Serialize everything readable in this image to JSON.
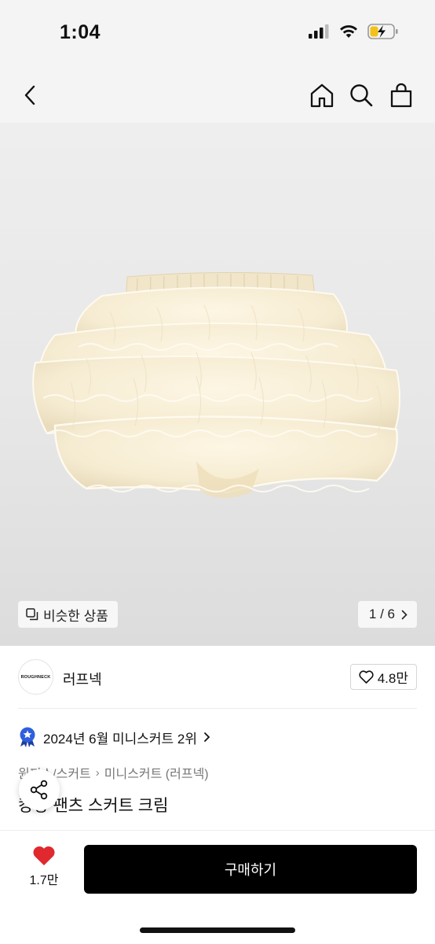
{
  "status": {
    "time": "1:04"
  },
  "nav": {
    "back_icon": "chevron-left-icon",
    "home_icon": "home-icon",
    "search_icon": "search-icon",
    "bag_icon": "shopping-bag-icon"
  },
  "hero": {
    "similar_label": "비슷한 상품",
    "page_indicator": "1 / 6"
  },
  "brand": {
    "logo_text": "ROUGHNECK",
    "name": "러프넥",
    "likes": "4.8만"
  },
  "ranking": {
    "text": "2024년 6월 미니스커트 2위"
  },
  "breadcrumb": {
    "items": [
      "원피스/스커트",
      "미니스커트 (러프넥)"
    ]
  },
  "product": {
    "title": "캉캉 팬츠 스커트 크림"
  },
  "bottom": {
    "wish_count": "1.7만",
    "buy_label": "구매하기"
  },
  "colors": {
    "accent": "#000000",
    "heart": "#e0282f",
    "badge_blue": "#2f5fe0"
  }
}
